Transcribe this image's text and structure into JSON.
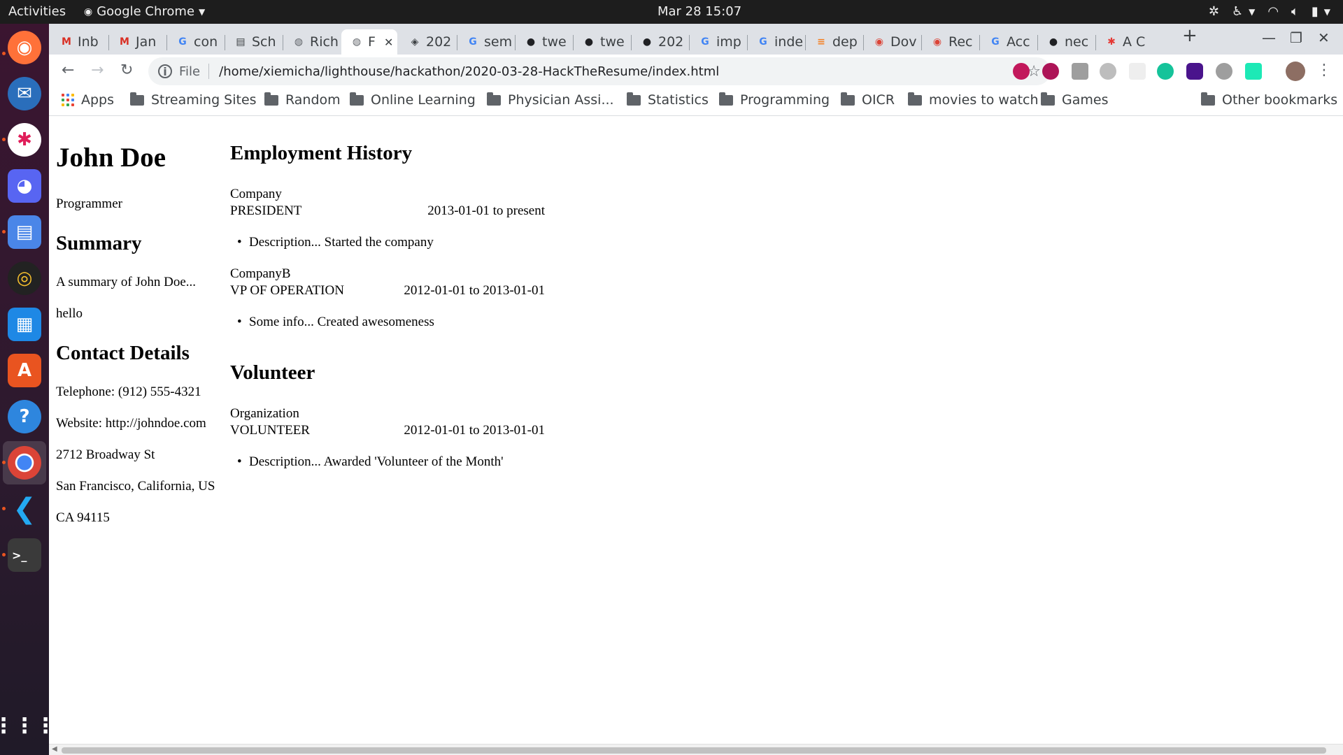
{
  "topbar": {
    "activities": "Activities",
    "app_name": "Google Chrome",
    "clock": "Mar 28  15:07"
  },
  "tabs": [
    {
      "icon_text": "M",
      "label": "Inb",
      "icon": "gmail-icon",
      "color": "#d93025"
    },
    {
      "icon_text": "M",
      "label": "Jan",
      "icon": "gmail-icon",
      "color": "#d93025"
    },
    {
      "icon_text": "G",
      "label": "con",
      "icon": "google-icon",
      "color": "#4285f4"
    },
    {
      "icon_text": "▤",
      "label": "Sch",
      "icon": "document-icon",
      "color": "#3c4043"
    },
    {
      "icon_text": "◍",
      "label": "Rich",
      "icon": "globe-icon",
      "color": "#5f6368"
    },
    {
      "icon_text": "◍",
      "label": "F",
      "icon": "globe-icon",
      "color": "#5f6368"
    },
    {
      "icon_text": "◈",
      "label": "202",
      "icon": "box-icon",
      "color": "#3c4043"
    },
    {
      "icon_text": "G",
      "label": "sem",
      "icon": "google-icon",
      "color": "#4285f4"
    },
    {
      "icon_text": "●",
      "label": "twe",
      "icon": "github-icon",
      "color": "#202124"
    },
    {
      "icon_text": "●",
      "label": "twe",
      "icon": "github-icon",
      "color": "#202124"
    },
    {
      "icon_text": "●",
      "label": "202",
      "icon": "github-icon",
      "color": "#202124"
    },
    {
      "icon_text": "G",
      "label": "imp",
      "icon": "google-icon",
      "color": "#4285f4"
    },
    {
      "icon_text": "G",
      "label": "inde",
      "icon": "google-icon",
      "color": "#4285f4"
    },
    {
      "icon_text": "≡",
      "label": "dep",
      "icon": "stackoverflow-icon",
      "color": "#f48024"
    },
    {
      "icon_text": "◉",
      "label": "Dov",
      "icon": "chrome-ext-icon",
      "color": "#db4437"
    },
    {
      "icon_text": "◉",
      "label": "Rec",
      "icon": "chrome-ext-icon",
      "color": "#db4437"
    },
    {
      "icon_text": "G",
      "label": "Acc",
      "icon": "google-icon",
      "color": "#4285f4"
    },
    {
      "icon_text": "●",
      "label": "nec",
      "icon": "github-icon",
      "color": "#202124"
    },
    {
      "icon_text": "✱",
      "label": "A C",
      "icon": "asterisk-icon",
      "color": "#e53935"
    }
  ],
  "toolbar": {
    "file_label": "File",
    "url": "/home/xiemicha/lighthouse/hackathon/2020-03-28-HackTheResume/index.html"
  },
  "bookmarks": {
    "apps": "Apps",
    "items": [
      "Streaming Sites",
      "Random",
      "Online Learning",
      "Physician Assi...",
      "Statistics",
      "Programming",
      "OICR",
      "movies to watch",
      "Games"
    ],
    "other": "Other bookmarks"
  },
  "resume": {
    "name": "John Doe",
    "title": "Programmer",
    "summary_heading": "Summary",
    "summary_text": "A summary of John Doe...",
    "summary_extra": "hello",
    "contact_heading": "Contact Details",
    "telephone": "Telephone: (912) 555-4321",
    "website": "Website: http://johndoe.com",
    "address1": "2712 Broadway St",
    "address2": "San Francisco, California, US",
    "address3": "CA 94115",
    "employment_heading": "Employment History",
    "jobs": [
      {
        "company": "Company",
        "position": "PRESIDENT",
        "dates": "2013-01-01 to present",
        "bullet": "Description... Started the company"
      },
      {
        "company": "CompanyB",
        "position": "VP OF OPERATION",
        "dates": "2012-01-01 to 2013-01-01",
        "bullet": "Some info... Created awesomeness"
      }
    ],
    "volunteer_heading": "Volunteer",
    "volunteer": {
      "org": "Organization",
      "role": "VOLUNTEER",
      "dates": "2012-01-01 to 2013-01-01",
      "bullet": "Description... Awarded 'Volunteer of the Month'"
    }
  }
}
